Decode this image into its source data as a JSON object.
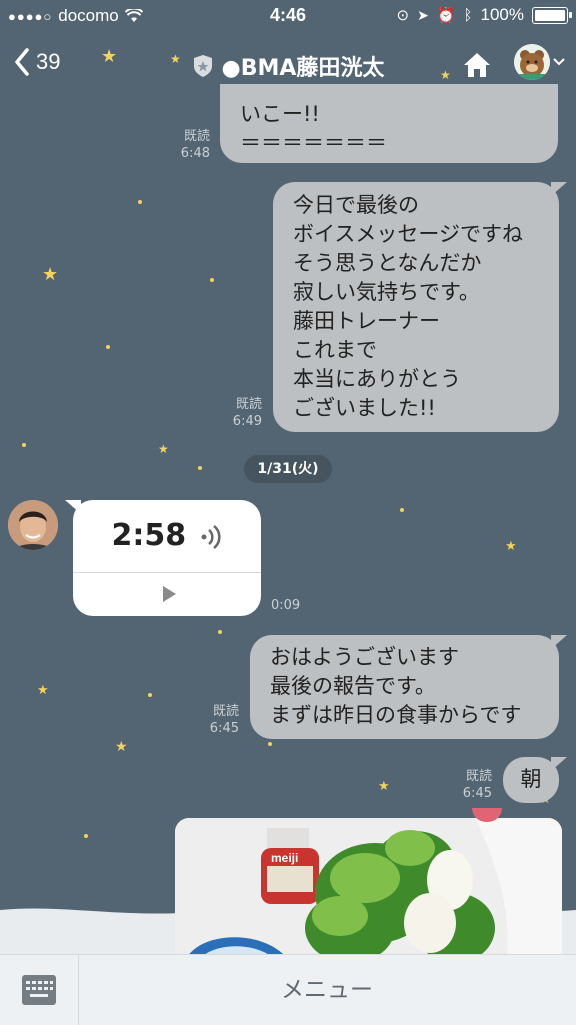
{
  "status_bar": {
    "carrier": "docomo",
    "time": "4:46",
    "battery": "100%"
  },
  "header": {
    "back_count": "39",
    "chat_title": "●BMA藤田洸太"
  },
  "messages": {
    "m1": {
      "lines": [
        "いこー!!",
        "＝＝＝＝＝＝＝"
      ],
      "read": "既読",
      "time": "6:48"
    },
    "m2": {
      "lines": [
        "今日で最後の",
        "ボイスメッセージですね",
        "そう思うとなんだか",
        "寂しい気持ちです。",
        "藤田トレーナー",
        "これまで",
        "本当にありがとう",
        "ございました!!"
      ],
      "read": "既読",
      "time": "6:49"
    },
    "date_divider": "1/31(火)",
    "voice": {
      "duration": "2:58",
      "time": "0:09"
    },
    "m3": {
      "lines": [
        "おはようございます",
        "最後の報告です。",
        "まずは昨日の食事からです"
      ],
      "read": "既読",
      "time": "6:45"
    },
    "m4": {
      "lines": [
        "朝"
      ],
      "read": "既読",
      "time": "6:45"
    },
    "photo_label": "meiji"
  },
  "footer": {
    "menu_label": "メニュー"
  },
  "colors": {
    "background": "#536573",
    "bubble": "#bcc0c3",
    "star": "#f3d35a"
  }
}
